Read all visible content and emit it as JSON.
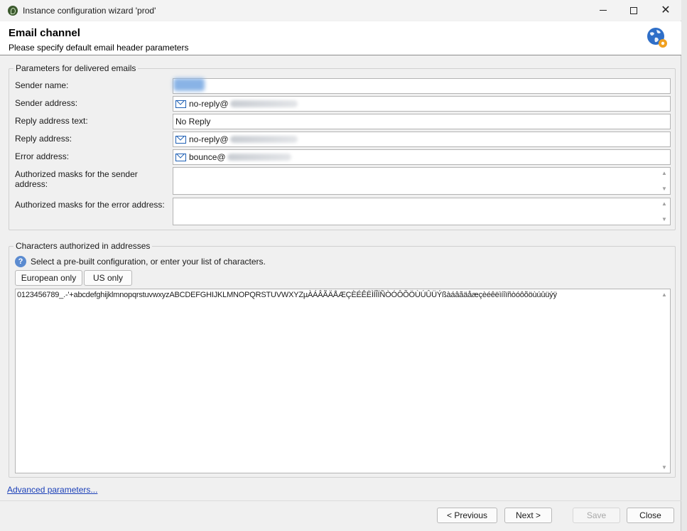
{
  "window": {
    "title": "Instance configuration wizard 'prod'"
  },
  "header": {
    "title": "Email channel",
    "subtitle": "Please specify default email header parameters"
  },
  "delivered": {
    "legend": "Parameters for delivered emails",
    "sender_name_label": "Sender name:",
    "sender_address_label": "Sender address:",
    "sender_address_value": "no-reply@",
    "reply_text_label": "Reply address text:",
    "reply_text_value": "No Reply",
    "reply_address_label": "Reply address:",
    "reply_address_value": "no-reply@",
    "error_address_label": "Error address:",
    "error_address_value": "bounce@",
    "auth_sender_label": "Authorized masks for the sender address:",
    "auth_error_label": "Authorized masks for the error address:"
  },
  "characters": {
    "legend": "Characters authorized in addresses",
    "hint": "Select a pre-built configuration, or enter your list of characters.",
    "european_button": "European only",
    "us_button": "US only",
    "value": "0123456789_.-'+abcdefghijklmnopqrstuvwxyzABCDEFGHIJKLMNOPQRSTUVWXYZµÀÁÂÃÄÅÆÇÈÉÊËÌÍÎÏÑÒÓÔÕÖÙÚÛÜÝßàáâãäåæçèéêëìíîïñòóôõöùúûüýÿ"
  },
  "footer": {
    "advanced_link": "Advanced parameters...",
    "previous_button": "< Previous",
    "next_button": "Next >",
    "save_button": "Save",
    "close_button": "Close"
  },
  "icons": {
    "app": "app-logo-icon",
    "globe": "globe-gear-icon",
    "mail": "mail-icon",
    "help": "help-icon"
  }
}
